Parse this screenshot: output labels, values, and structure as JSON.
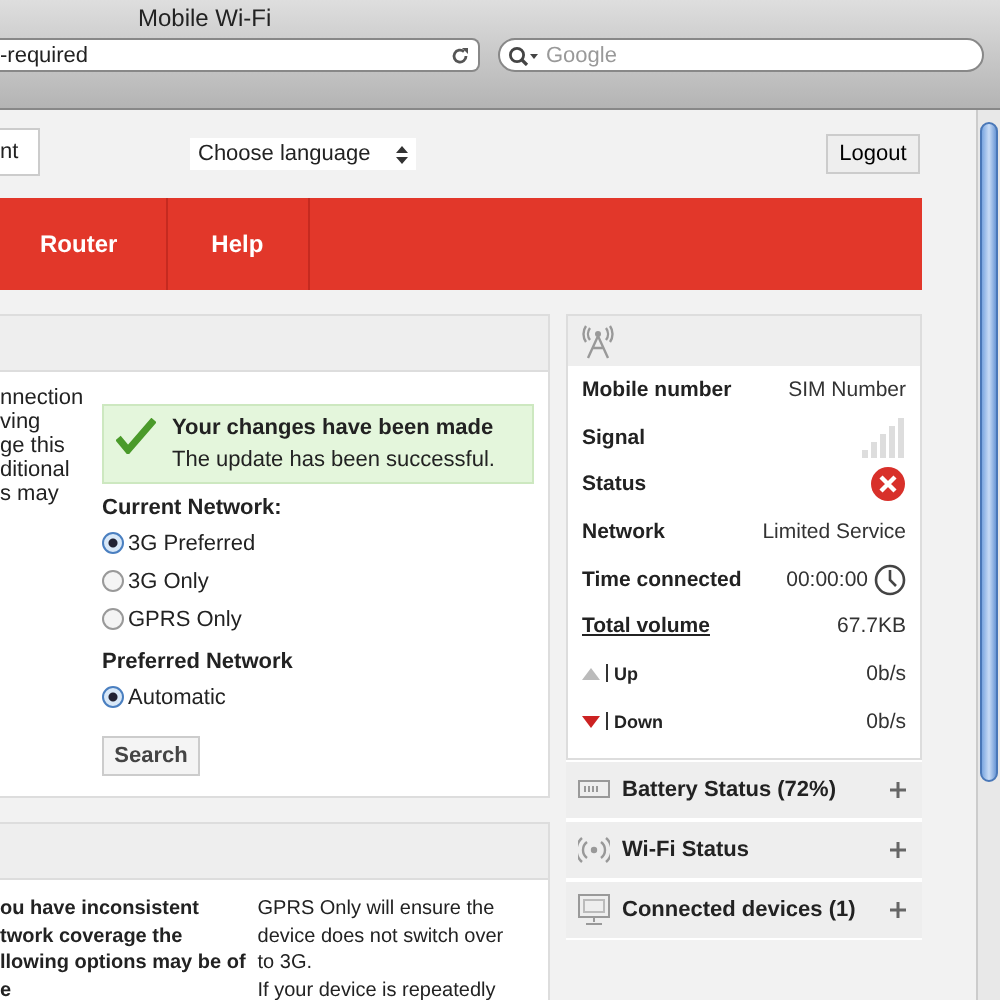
{
  "window": {
    "title": "Mobile Wi-Fi"
  },
  "address_bar": {
    "value": "-required"
  },
  "search": {
    "placeholder": "Google"
  },
  "top_bar": {
    "tab": "nt",
    "language_select": "Choose language",
    "logout": "Logout"
  },
  "nav": [
    {
      "label": "Router"
    },
    {
      "label": "Help"
    }
  ],
  "network_panel": {
    "intro_lines": [
      "nnection",
      "ving",
      "ge this",
      "ditional",
      "s may"
    ],
    "message": {
      "title": "Your changes have been made",
      "text": "The update has been successful."
    },
    "current_network": {
      "label": "Current Network:",
      "options": [
        {
          "label": "3G Preferred",
          "selected": true
        },
        {
          "label": "3G Only",
          "selected": false
        },
        {
          "label": "GPRS Only",
          "selected": false
        }
      ]
    },
    "preferred_network": {
      "label": "Preferred Network",
      "options": [
        {
          "label": "Automatic",
          "selected": true
        }
      ]
    },
    "search_button": "Search"
  },
  "info_panel": {
    "left_lines": [
      "ou have inconsistent",
      "twork coverage the",
      "llowing options may be of",
      "e"
    ],
    "right_lines": [
      "GPRS Only will ensure the",
      "device does not switch over",
      "to 3G.",
      "If your device is repeatedly"
    ]
  },
  "status_panel": {
    "rows": [
      {
        "kind": "text",
        "label": "Mobile number",
        "value": "SIM Number"
      },
      {
        "kind": "signal",
        "label": "Signal"
      },
      {
        "kind": "error",
        "label": "Status"
      },
      {
        "kind": "text",
        "label": "Network",
        "value": "Limited Service"
      },
      {
        "kind": "time",
        "label": "Time connected",
        "value": "00:00:00"
      },
      {
        "kind": "link",
        "label": "Total volume",
        "value": "67.7KB"
      },
      {
        "kind": "up",
        "label": "Up",
        "value": "0b/s"
      },
      {
        "kind": "down",
        "label": "Down",
        "value": "0b/s"
      }
    ]
  },
  "sections": [
    {
      "kind": "battery",
      "label": "Battery Status (72%)",
      "expanded": false
    },
    {
      "kind": "wifi",
      "label": "Wi-Fi Status",
      "expanded": false
    },
    {
      "kind": "devices",
      "label": "Connected devices (1)",
      "expanded": false
    }
  ]
}
